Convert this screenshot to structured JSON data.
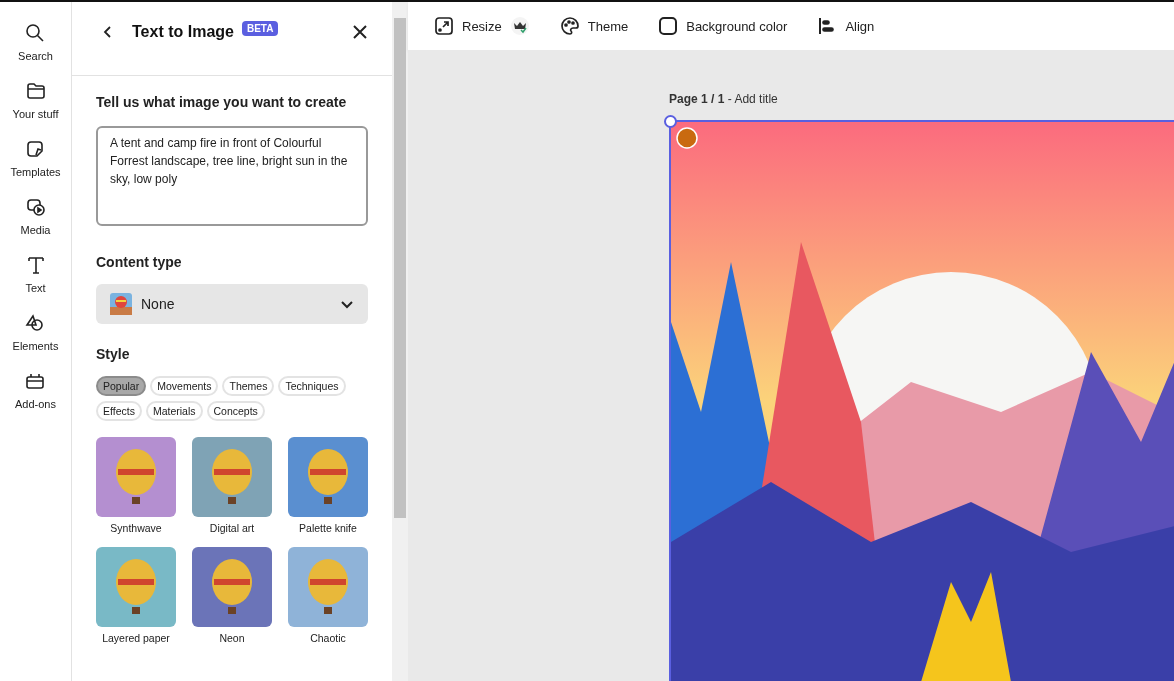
{
  "rail": [
    {
      "kind": "search",
      "label": "Search"
    },
    {
      "kind": "folder",
      "label": "Your stuff"
    },
    {
      "kind": "templates",
      "label": "Templates"
    },
    {
      "kind": "media",
      "label": "Media"
    },
    {
      "kind": "text",
      "label": "Text"
    },
    {
      "kind": "elements",
      "label": "Elements"
    },
    {
      "kind": "addons",
      "label": "Add-ons"
    }
  ],
  "panel": {
    "title": "Text to Image",
    "badge": "BETA",
    "prompt_label": "Tell us what image you want to create",
    "prompt_value": "A tent and camp fire in front of Colourful Forrest landscape, tree line, bright sun in the sky, low poly",
    "content_type_label": "Content type",
    "content_type_value": "None",
    "style_label": "Style",
    "style_tabs": [
      {
        "label": "Popular",
        "selected": true
      },
      {
        "label": "Movements",
        "selected": false
      },
      {
        "label": "Themes",
        "selected": false
      },
      {
        "label": "Techniques",
        "selected": false
      },
      {
        "label": "Effects",
        "selected": false
      },
      {
        "label": "Materials",
        "selected": false
      },
      {
        "label": "Concepts",
        "selected": false
      }
    ],
    "styles": [
      {
        "label": "Synthwave",
        "color": "#b48fd0"
      },
      {
        "label": "Digital art",
        "color": "#7fa3b5"
      },
      {
        "label": "Palette knife",
        "color": "#5a8fd0"
      },
      {
        "label": "Layered paper",
        "color": "#79b9c6"
      },
      {
        "label": "Neon",
        "color": "#6b74b8"
      },
      {
        "label": "Chaotic",
        "color": "#8fb3d8"
      }
    ]
  },
  "toolbar": [
    {
      "kind": "resize",
      "label": "Resize",
      "premium": true
    },
    {
      "kind": "theme",
      "label": "Theme",
      "premium": false
    },
    {
      "kind": "background",
      "label": "Background color",
      "premium": false
    },
    {
      "kind": "align",
      "label": "Align",
      "premium": false
    }
  ],
  "canvas": {
    "page": "Page 1 / 1",
    "separator": " - ",
    "title_placeholder": "Add title"
  }
}
